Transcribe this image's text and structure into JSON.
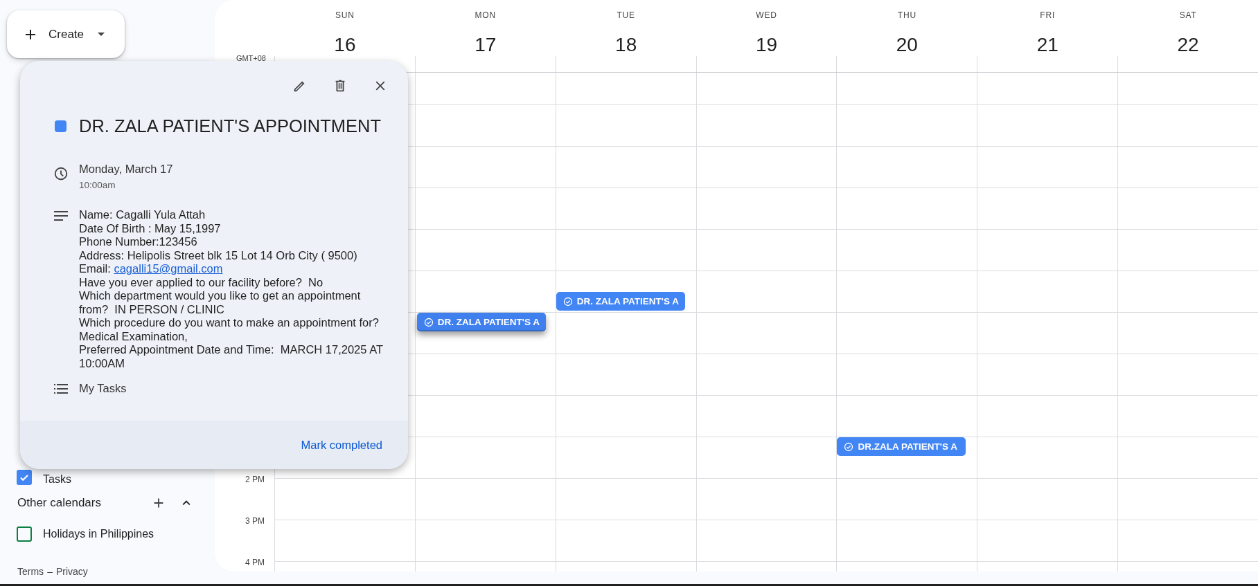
{
  "create_button": {
    "label": "Create"
  },
  "my_calendars": [
    {
      "label": "Tasks",
      "checked": true,
      "color": "#4285f4"
    }
  ],
  "other_calendars": {
    "title": "Other calendars",
    "items": [
      {
        "label": "Holidays in Philippines",
        "checked": false,
        "color": "#0b8043"
      }
    ]
  },
  "footer": {
    "terms": "Terms",
    "separator": "–",
    "privacy": "Privacy"
  },
  "timezone": "GMT+08",
  "days": [
    {
      "name": "SUN",
      "date": "16"
    },
    {
      "name": "MON",
      "date": "17"
    },
    {
      "name": "TUE",
      "date": "18"
    },
    {
      "name": "WED",
      "date": "19"
    },
    {
      "name": "THU",
      "date": "20"
    },
    {
      "name": "FRI",
      "date": "21"
    },
    {
      "name": "SAT",
      "date": "22"
    }
  ],
  "events": [
    {
      "title": "DR. ZALA PATIENT'S A",
      "raised": true
    },
    {
      "title": "DR. ZALA PATIENT'S A",
      "raised": false
    },
    {
      "title": "DR.ZALA PATIENT'S A",
      "raised": false
    }
  ],
  "hour_labels": [
    "2 PM",
    "3 PM",
    "4 PM"
  ],
  "popup": {
    "title": "DR. ZALA PATIENT'S APPOINTMENT",
    "color": "#4285f4",
    "date": "Monday, March 17",
    "time": "10:00am",
    "description": [
      {
        "text": "Name: Cagalli Yula Attah"
      },
      {
        "text": "Date Of Birth : May 15,1997"
      },
      {
        "text": "Phone Number:123456"
      },
      {
        "text": "Address: Helipolis Street blk 15 Lot 14 Orb City ( 9500)"
      },
      {
        "text": "Email: ",
        "link": "cagalli15@gmail.com"
      },
      {
        "text": "Have you ever applied to our facility before?  No"
      },
      {
        "text": "Which department would you like to get an appointment from?  IN PERSON / CLINIC"
      },
      {
        "text": "Which procedure do you want to make an appointment for? Medical Examination,"
      },
      {
        "text": "Preferred Appointment Date and Time:  MARCH 17,2025 AT 10:00AM"
      }
    ],
    "task_list": "My Tasks",
    "action": "Mark completed"
  }
}
